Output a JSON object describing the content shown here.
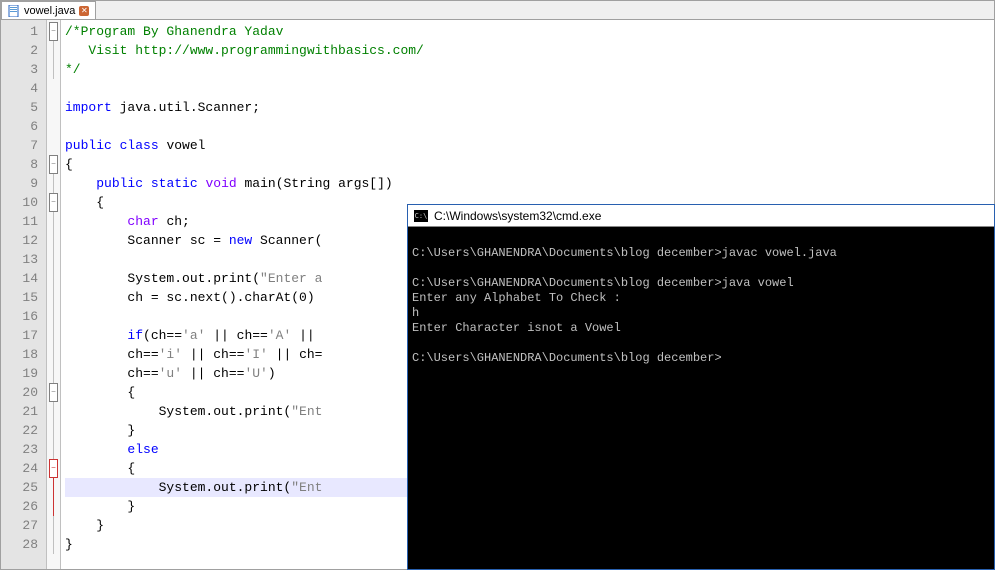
{
  "tab": {
    "filename": "vowel.java"
  },
  "editor": {
    "lines": [
      {
        "n": 1,
        "fold": "box",
        "html": "<span class='c-comment'>/*Program By Ghanendra Yadav</span>"
      },
      {
        "n": 2,
        "fold": "line",
        "html": "<span class='c-comment'>   Visit http://www.programmingwithbasics.com/</span>"
      },
      {
        "n": 3,
        "fold": "lineend",
        "html": "<span class='c-comment'>*/</span>"
      },
      {
        "n": 4,
        "fold": "",
        "html": ""
      },
      {
        "n": 5,
        "fold": "",
        "html": "<span class='c-keyword'>import</span><span class='c-default'> java.util.Scanner;</span>"
      },
      {
        "n": 6,
        "fold": "",
        "html": ""
      },
      {
        "n": 7,
        "fold": "",
        "html": "<span class='c-keyword'>public</span><span class='c-default'> </span><span class='c-keyword'>class</span><span class='c-default'> vowel</span>"
      },
      {
        "n": 8,
        "fold": "box",
        "html": "<span class='c-default'>{</span>"
      },
      {
        "n": 9,
        "fold": "line",
        "html": "<span class='c-default'>    </span><span class='c-keyword'>public</span><span class='c-default'> </span><span class='c-keyword'>static</span><span class='c-default'> </span><span class='c-type'>void</span><span class='c-default'> main(String args[])</span>"
      },
      {
        "n": 10,
        "fold": "box",
        "html": "<span class='c-default'>    {</span>"
      },
      {
        "n": 11,
        "fold": "line",
        "html": "<span class='c-default'>        </span><span class='c-type'>char</span><span class='c-default'> ch;</span>"
      },
      {
        "n": 12,
        "fold": "line",
        "html": "<span class='c-default'>        Scanner sc = </span><span class='c-keyword'>new</span><span class='c-default'> Scanner(</span>"
      },
      {
        "n": 13,
        "fold": "line",
        "html": ""
      },
      {
        "n": 14,
        "fold": "line",
        "html": "<span class='c-default'>        System.out.print(</span><span class='c-string'>\"Enter a</span>"
      },
      {
        "n": 15,
        "fold": "line",
        "html": "<span class='c-default'>        ch = sc.next().charAt(</span><span class='c-default'>0</span><span class='c-default'>)</span>"
      },
      {
        "n": 16,
        "fold": "line",
        "html": ""
      },
      {
        "n": 17,
        "fold": "line",
        "html": "<span class='c-default'>        </span><span class='c-keyword'>if</span><span class='c-default'>(ch==</span><span class='c-char'>'a'</span><span class='c-default'> || ch==</span><span class='c-char'>'A'</span><span class='c-default'> ||</span>"
      },
      {
        "n": 18,
        "fold": "line",
        "html": "<span class='c-default'>        ch==</span><span class='c-char'>'i'</span><span class='c-default'> || ch==</span><span class='c-char'>'I'</span><span class='c-default'> || ch=</span>"
      },
      {
        "n": 19,
        "fold": "line",
        "html": "<span class='c-default'>        ch==</span><span class='c-char'>'u'</span><span class='c-default'> || ch==</span><span class='c-char'>'U'</span><span class='c-default'>)</span>"
      },
      {
        "n": 20,
        "fold": "box",
        "html": "<span class='c-default'>        {</span>"
      },
      {
        "n": 21,
        "fold": "line",
        "html": "<span class='c-default'>            System.out.print(</span><span class='c-string'>\"Ent</span>"
      },
      {
        "n": 22,
        "fold": "line",
        "html": "<span class='c-default'>        }</span>"
      },
      {
        "n": 23,
        "fold": "line",
        "html": "<span class='c-default'>        </span><span class='c-keyword'>else</span>"
      },
      {
        "n": 24,
        "fold": "boxred",
        "html": "<span class='c-default'>        {</span>"
      },
      {
        "n": 25,
        "fold": "linered",
        "hl": true,
        "html": "<span class='c-default'>            System.out.print(</span><span class='c-string'>\"Ent</span>"
      },
      {
        "n": 26,
        "fold": "linered",
        "html": "<span class='c-default'>        }</span>"
      },
      {
        "n": 27,
        "fold": "line",
        "html": "<span class='c-default'>    }</span>"
      },
      {
        "n": 28,
        "fold": "lineend",
        "html": "<span class='c-default'>}</span>"
      }
    ]
  },
  "cmd": {
    "title": "C:\\Windows\\system32\\cmd.exe",
    "body": "\nC:\\Users\\GHANENDRA\\Documents\\blog december>javac vowel.java\n\nC:\\Users\\GHANENDRA\\Documents\\blog december>java vowel\nEnter any Alphabet To Check :\nh\nEnter Character isnot a Vowel\n\nC:\\Users\\GHANENDRA\\Documents\\blog december>"
  }
}
